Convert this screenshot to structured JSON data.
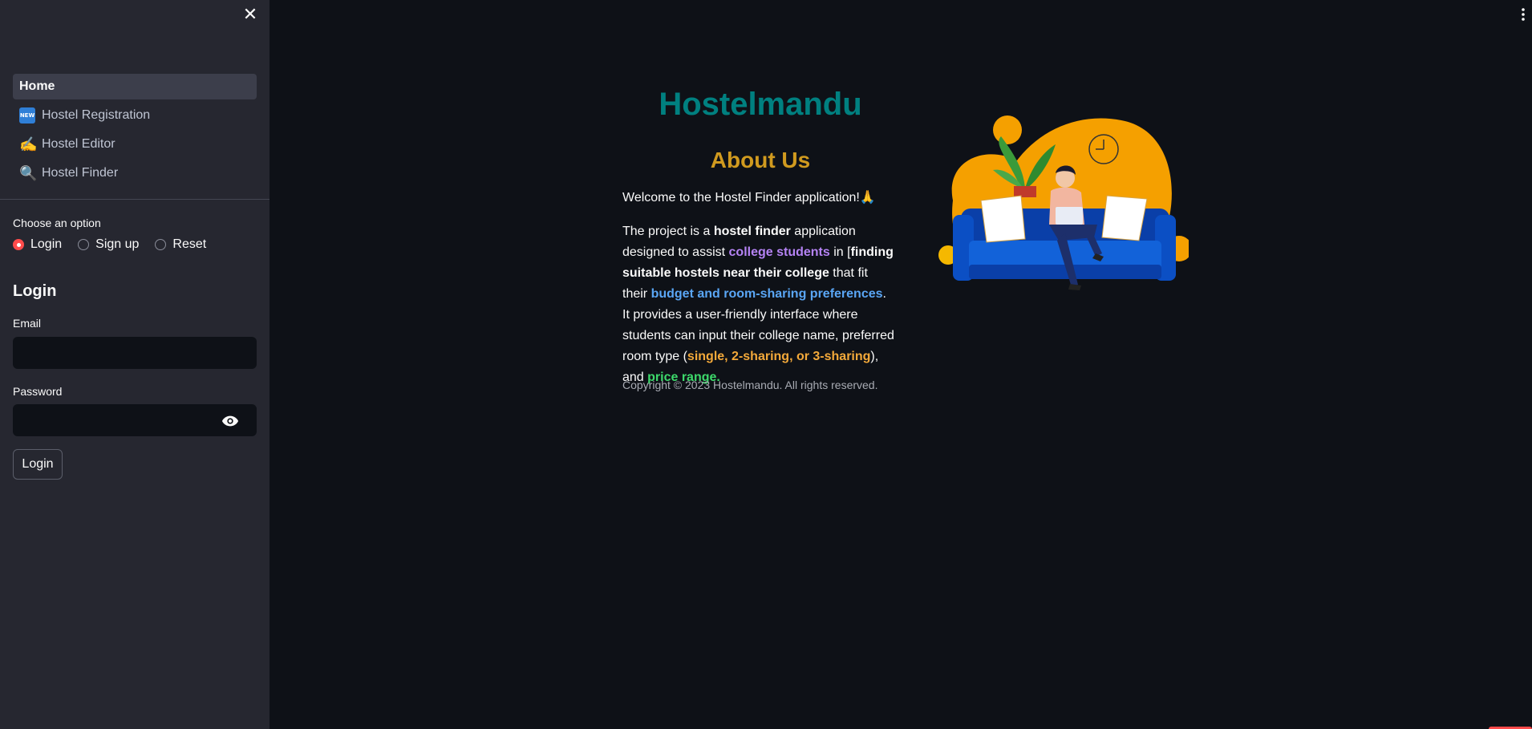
{
  "sidebar": {
    "nav": [
      {
        "label": "Home",
        "emoji": ""
      },
      {
        "label": "Hostel Registration",
        "emoji": "NEW"
      },
      {
        "label": "Hostel Editor",
        "emoji": "✍️"
      },
      {
        "label": "Hostel Finder",
        "emoji": "🔍"
      }
    ],
    "choose_label": "Choose an option",
    "options": [
      "Login",
      "Sign up",
      "Reset"
    ],
    "selected_option": "Login",
    "login_heading": "Login",
    "email_label": "Email",
    "email_value": "",
    "password_label": "Password",
    "password_value": "",
    "login_button": "Login",
    "icons": {
      "close": "close-icon",
      "eye": "eye-icon"
    }
  },
  "main": {
    "title": "Hostelmandu",
    "about_title": "About Us",
    "welcome": "Welcome to the Hostel Finder application!🙏",
    "paragraph": {
      "p1": "The project is a ",
      "p2": "hostel finder",
      "p3": " application designed to assist ",
      "p4": "college students",
      "p5": " in [",
      "p6": "finding suitable hostels near their college",
      "p7": " that fit their ",
      "p8": "budget and room-sharing preferences",
      "p9": ". It provides a user-friendly interface where students can input their college name, preferred room type (",
      "p10": "single, 2-sharing, or 3-sharing",
      "p11": "), and ",
      "p12": "price range."
    },
    "copyright": "Copyright © 2023 Hostelmandu. All rights reserved."
  },
  "colors": {
    "background": "#0e1117",
    "sidebar": "#262730",
    "title": "#008080",
    "about": "#d09a1f",
    "accent": "#ff4b4b"
  }
}
